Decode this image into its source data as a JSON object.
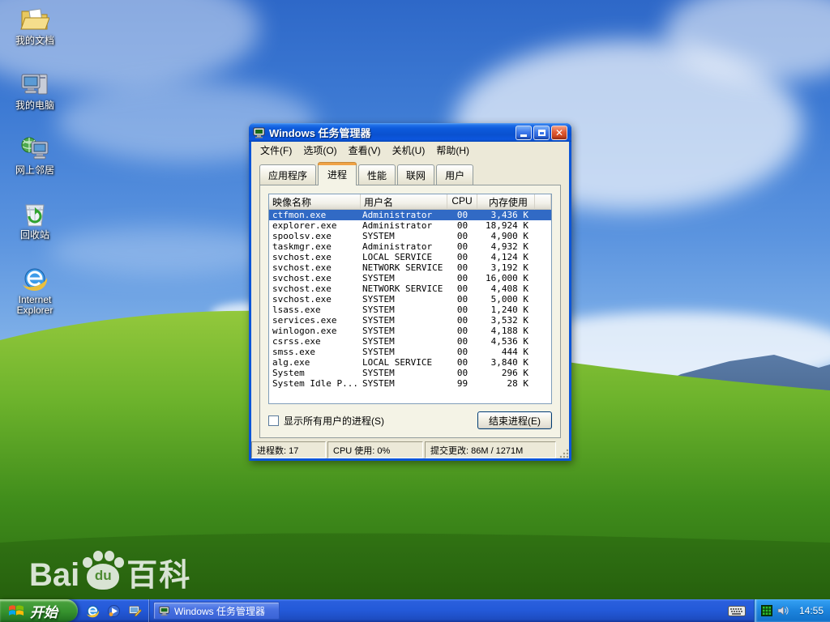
{
  "desktop": {
    "icons": [
      {
        "label": "我的文档",
        "icon": "my-documents"
      },
      {
        "label": "我的电脑",
        "icon": "my-computer"
      },
      {
        "label": "网上邻居",
        "icon": "network-places"
      },
      {
        "label": "回收站",
        "icon": "recycle-bin"
      },
      {
        "label": "Internet Explorer",
        "icon": "internet-explorer"
      }
    ],
    "watermark": {
      "part1": "Bai",
      "part2": "du",
      "part3": "百科"
    }
  },
  "window": {
    "title": "Windows 任务管理器",
    "menu": [
      "文件(F)",
      "选项(O)",
      "查看(V)",
      "关机(U)",
      "帮助(H)"
    ],
    "tabs": [
      {
        "label": "应用程序"
      },
      {
        "label": "进程",
        "active": true
      },
      {
        "label": "性能"
      },
      {
        "label": "联网"
      },
      {
        "label": "用户"
      }
    ],
    "table": {
      "headers": [
        "映像名称",
        "用户名",
        "CPU",
        "内存使用"
      ],
      "rows": [
        {
          "name": "ctfmon.exe",
          "user": "Administrator",
          "cpu": "00",
          "mem": "3,436 K",
          "selected": true
        },
        {
          "name": "explorer.exe",
          "user": "Administrator",
          "cpu": "00",
          "mem": "18,924 K"
        },
        {
          "name": "spoolsv.exe",
          "user": "SYSTEM",
          "cpu": "00",
          "mem": "4,900 K"
        },
        {
          "name": "taskmgr.exe",
          "user": "Administrator",
          "cpu": "00",
          "mem": "4,932 K"
        },
        {
          "name": "svchost.exe",
          "user": "LOCAL SERVICE",
          "cpu": "00",
          "mem": "4,124 K"
        },
        {
          "name": "svchost.exe",
          "user": "NETWORK SERVICE",
          "cpu": "00",
          "mem": "3,192 K"
        },
        {
          "name": "svchost.exe",
          "user": "SYSTEM",
          "cpu": "00",
          "mem": "16,000 K"
        },
        {
          "name": "svchost.exe",
          "user": "NETWORK SERVICE",
          "cpu": "00",
          "mem": "4,408 K"
        },
        {
          "name": "svchost.exe",
          "user": "SYSTEM",
          "cpu": "00",
          "mem": "5,000 K"
        },
        {
          "name": "lsass.exe",
          "user": "SYSTEM",
          "cpu": "00",
          "mem": "1,240 K"
        },
        {
          "name": "services.exe",
          "user": "SYSTEM",
          "cpu": "00",
          "mem": "3,532 K"
        },
        {
          "name": "winlogon.exe",
          "user": "SYSTEM",
          "cpu": "00",
          "mem": "4,188 K"
        },
        {
          "name": "csrss.exe",
          "user": "SYSTEM",
          "cpu": "00",
          "mem": "4,536 K"
        },
        {
          "name": "smss.exe",
          "user": "SYSTEM",
          "cpu": "00",
          "mem": "444 K"
        },
        {
          "name": "alg.exe",
          "user": "LOCAL SERVICE",
          "cpu": "00",
          "mem": "3,840 K"
        },
        {
          "name": "System",
          "user": "SYSTEM",
          "cpu": "00",
          "mem": "296 K"
        },
        {
          "name": "System Idle P...",
          "user": "SYSTEM",
          "cpu": "99",
          "mem": "28 K"
        }
      ]
    },
    "show_all_label": "显示所有用户的进程(S)",
    "end_process_label": "结束进程(E)",
    "status": {
      "processes": "进程数: 17",
      "cpu": "CPU 使用: 0%",
      "commit": "提交更改: 86M / 1271M"
    }
  },
  "taskbar": {
    "start_label": "开始",
    "task_button": "Windows 任务管理器",
    "tray_time": "14:55"
  },
  "colors": {
    "selection": "#316AC5",
    "active_tab_indicator": "#F0A245",
    "window_border": "#0B55D8",
    "taskbar_blue": "#2359D8",
    "start_green": "#36922E",
    "desktop_grass": "#57A527"
  }
}
